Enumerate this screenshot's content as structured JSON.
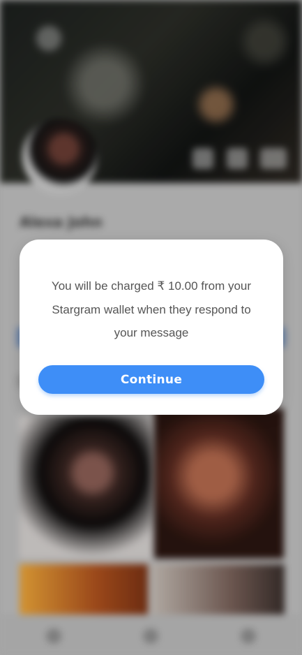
{
  "profile": {
    "name": "Alexa John"
  },
  "modal": {
    "message": "You will be charged ₹ 10.00 from your Stargram wallet when they respond to your message",
    "continue_label": "Continue"
  },
  "colors": {
    "accent": "#3e8ef7",
    "modal_bg": "#ffffff",
    "text": "#555555"
  },
  "icons": {
    "cover_actions": [
      "photo-icon",
      "message-icon",
      "video-icon"
    ],
    "bottom_nav": [
      "search-icon",
      "chat-icon",
      "profile-icon"
    ]
  }
}
